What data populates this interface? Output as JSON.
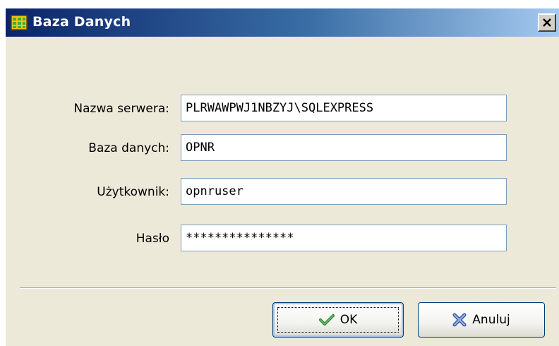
{
  "window": {
    "title": "Baza Danych",
    "close_label": "×"
  },
  "fields": [
    {
      "label": "Nazwa serwera:",
      "value": "PLRWAWPWJ1NBZYJ\\SQLEXPRESS"
    },
    {
      "label": "Baza danych:",
      "value": "OPNR"
    },
    {
      "label": "Użytkownik:",
      "value": "opnruser"
    },
    {
      "label": "Hasło",
      "value": "***************"
    }
  ],
  "buttons": {
    "ok_label": "OK",
    "cancel_label": "Anuluj"
  },
  "icons": {
    "app": "database-grid-icon",
    "close": "close-icon",
    "ok": "checkmark-icon",
    "cancel": "cross-icon"
  }
}
